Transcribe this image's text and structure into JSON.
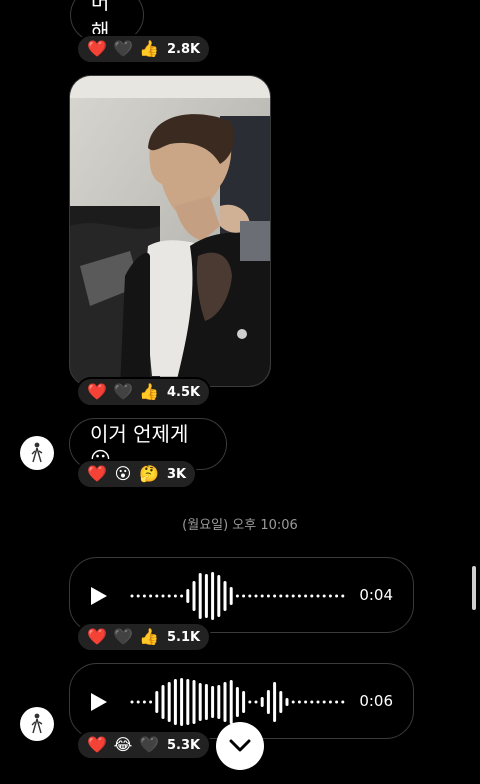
{
  "messages": [
    {
      "type": "text",
      "text": "머해",
      "reactions": [
        {
          "icon": "heart-red",
          "glyph": "❤️"
        },
        {
          "icon": "heart-black",
          "glyph": "🖤"
        },
        {
          "icon": "thumbs-up",
          "glyph": "👍"
        }
      ],
      "count": "2.8K"
    },
    {
      "type": "photo",
      "reactions": [
        {
          "icon": "heart-red",
          "glyph": "❤️"
        },
        {
          "icon": "heart-black",
          "glyph": "🖤"
        },
        {
          "icon": "thumbs-up",
          "glyph": "👍"
        }
      ],
      "count": "4.5K"
    },
    {
      "type": "text",
      "text": "이거 언제게😛",
      "reactions": [
        {
          "icon": "heart-red",
          "glyph": "❤️"
        },
        {
          "icon": "surprised-face",
          "glyph": "😮"
        },
        {
          "icon": "thinking-face",
          "glyph": "🤔"
        }
      ],
      "count": "3K"
    },
    {
      "type": "voice",
      "duration": "0:04",
      "reactions": [
        {
          "icon": "heart-red",
          "glyph": "❤️"
        },
        {
          "icon": "heart-black",
          "glyph": "🖤"
        },
        {
          "icon": "thumbs-up",
          "glyph": "👍"
        }
      ],
      "count": "5.1K"
    },
    {
      "type": "voice",
      "duration": "0:06",
      "reactions": [
        {
          "icon": "heart-red",
          "glyph": "❤️"
        },
        {
          "icon": "tears-of-joy-face",
          "glyph": "😂"
        },
        {
          "icon": "heart-black",
          "glyph": "🖤"
        }
      ],
      "count": "5.3K"
    }
  ],
  "timestamp": "(월요일) 오후 10:06",
  "colors": {
    "background": "#000000",
    "bubble_border": "#3a3a3a",
    "reaction_pill": "#222222",
    "heart": "#e0245e"
  }
}
